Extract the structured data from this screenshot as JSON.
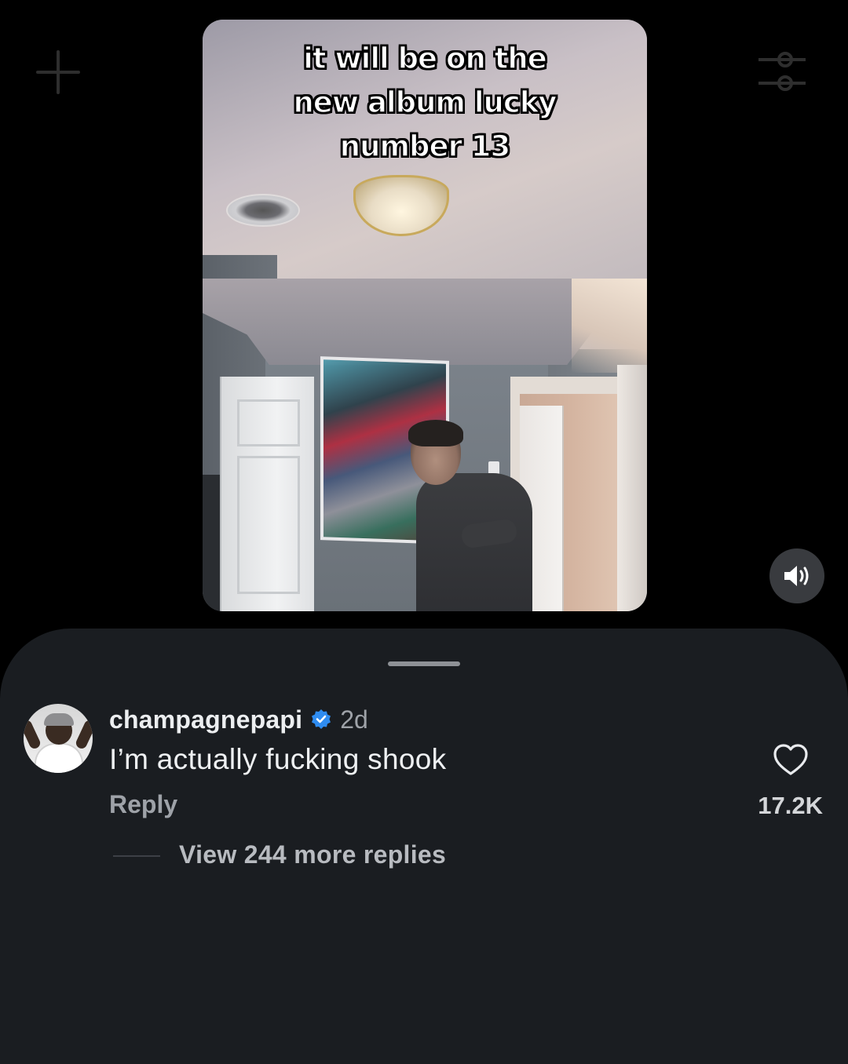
{
  "video": {
    "caption_lines": [
      "it will be on the",
      "new album lucky",
      "number 13"
    ]
  },
  "icons": {
    "top_left": "plus-icon",
    "top_right": "filter-icon",
    "mute": "speaker-icon",
    "verified": "verified-badge-icon",
    "like": "heart-icon"
  },
  "colors": {
    "sheet_background": "#1a1d21",
    "verified_blue": "#2f8cf0",
    "muted_text": "#9ea2a8"
  },
  "comment": {
    "username": "champagnepapi",
    "timestamp": "2d",
    "text": "I’m actually fucking shook",
    "reply_label": "Reply",
    "like_count": "17.2K",
    "view_replies_label": "View 244 more replies"
  }
}
